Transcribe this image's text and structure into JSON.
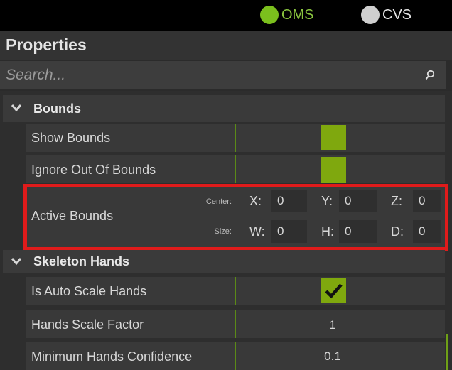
{
  "header": {
    "modes": [
      {
        "label": "OMS",
        "active": true,
        "color": "#7bbf1d"
      },
      {
        "label": "CVS",
        "active": false,
        "color": "#cfcfcf"
      }
    ],
    "title": "Properties"
  },
  "search": {
    "placeholder": "Search...",
    "value": ""
  },
  "sections": {
    "bounds": {
      "label": "Bounds",
      "rows": {
        "show_bounds": {
          "label": "Show Bounds",
          "checked": true
        },
        "ignore_out_of_bounds": {
          "label": "Ignore Out Of Bounds",
          "checked": true
        },
        "active_bounds": {
          "label": "Active Bounds",
          "center_label": "Center:",
          "size_label": "Size:",
          "center": {
            "x_label": "X:",
            "x": "0",
            "y_label": "Y:",
            "y": "0",
            "z_label": "Z:",
            "z": "0"
          },
          "size": {
            "w_label": "W:",
            "w": "0",
            "h_label": "H:",
            "h": "0",
            "d_label": "D:",
            "d": "0"
          }
        }
      }
    },
    "skeleton_hands": {
      "label": "Skeleton Hands",
      "rows": {
        "is_auto_scale_hands": {
          "label": "Is Auto Scale Hands",
          "checked": true
        },
        "hands_scale_factor": {
          "label": "Hands Scale Factor",
          "value": "1"
        },
        "minimum_hands_confidence": {
          "label": "Minimum Hands Confidence",
          "value": "0.1"
        }
      }
    }
  },
  "colors": {
    "accent": "#7fa80e",
    "highlight_box": "#e01b1b",
    "background": "#2b2b2b"
  },
  "icons": [
    "search-icon",
    "chevron-down-icon",
    "checkmark-icon"
  ]
}
